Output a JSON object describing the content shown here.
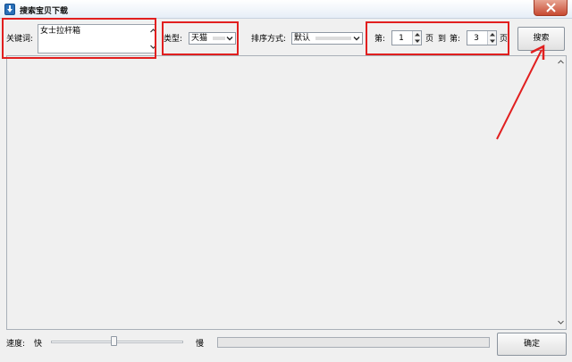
{
  "window": {
    "title": "搜索宝贝下载",
    "app_icon": "download-arrow-icon",
    "close_icon": "close-icon",
    "accent_close": "#c74a32"
  },
  "keyword": {
    "label": "关键词:",
    "value": "女士拉杆箱"
  },
  "type_select": {
    "label": "类型:",
    "value": "天猫"
  },
  "sort_select": {
    "label": "排序方式:",
    "value": "默认"
  },
  "pages": {
    "from_prefix": "第:",
    "from_value": "1",
    "from_suffix": "页",
    "to_word": "到",
    "to_prefix": "第:",
    "to_value": "3",
    "to_suffix": "页"
  },
  "search_button": {
    "label": "搜索"
  },
  "speed": {
    "label": "速度:",
    "fast": "快",
    "slow": "慢",
    "level": 0.47
  },
  "progress": {
    "fraction": 0
  },
  "confirm_button": {
    "label": "确定"
  },
  "annotation_color": "#e11f1f"
}
